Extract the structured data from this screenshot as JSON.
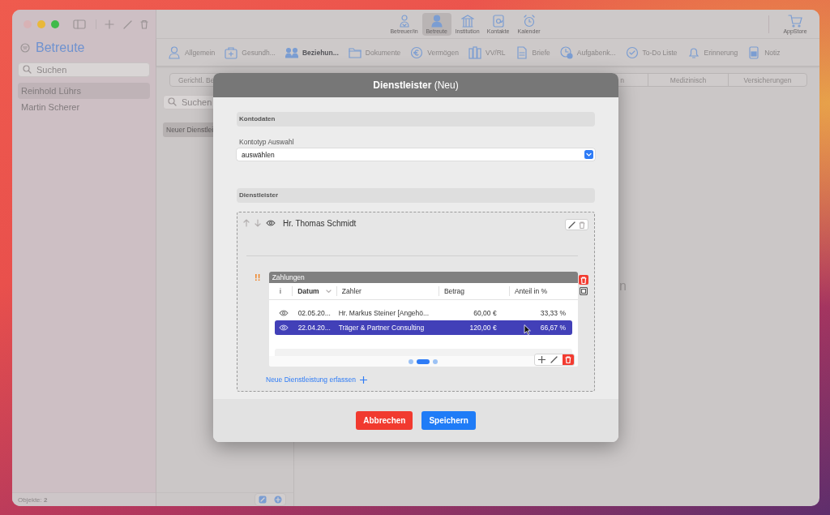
{
  "toolbar": {
    "items": [
      {
        "label": "Betreuer/in",
        "selected": false
      },
      {
        "label": "Betreute",
        "selected": true
      },
      {
        "label": "Institution",
        "selected": false
      },
      {
        "label": "Kontakte",
        "selected": false
      },
      {
        "label": "Kalender",
        "selected": false
      }
    ],
    "store": {
      "label": "AppStore"
    }
  },
  "sidebar": {
    "title": "Betreute",
    "search": {
      "placeholder": "Suchen"
    },
    "items": [
      {
        "label": "Reinhold Lührs",
        "selected": true
      },
      {
        "label": "Martin Scherer",
        "selected": false
      }
    ],
    "footer": "Objekte: **2**"
  },
  "tabs": [
    {
      "label": "Allgemein",
      "selected": false
    },
    {
      "label": "Gesundh...",
      "selected": false
    },
    {
      "label": "Beziehun...",
      "selected": true
    },
    {
      "label": "Dokumente",
      "selected": false
    },
    {
      "label": "Vermögen",
      "selected": false
    },
    {
      "label": "VV/RL",
      "selected": false
    },
    {
      "label": "Briefe",
      "selected": false
    },
    {
      "label": "Aufgabenk...",
      "selected": false
    },
    {
      "label": "To-Do Liste",
      "selected": false
    },
    {
      "label": "Erinnerung",
      "selected": false
    },
    {
      "label": "Notiz",
      "selected": false
    }
  ],
  "segments": [
    {
      "label": "Gerichtl. Be"
    },
    {
      "label": "n"
    },
    {
      "label": "Medizinisch"
    },
    {
      "label": "Versicherungen"
    }
  ],
  "list": {
    "search": {
      "placeholder": "Suchen"
    },
    "items": [
      {
        "label": "Neuer Dienstlei",
        "selected": true
      }
    ]
  },
  "detail_text": "n",
  "dialog": {
    "title": "**Dienstleister** (Neu)",
    "account": {
      "heading": "Kontodaten",
      "field_label": "Kontotyp Auswahl",
      "value": "auswählen"
    },
    "providers": {
      "heading": "Dienstleister",
      "entry": {
        "name": "Hr. Thomas Schmidt",
        "warning": "!!",
        "table": {
          "title": "Zahlungen",
          "columns": [
            {
              "label": "i",
              "sorted": false
            },
            {
              "label": "Datum",
              "sorted": true
            },
            {
              "label": "Zahler",
              "sorted": false
            },
            {
              "label": "Betrag",
              "sorted": false
            },
            {
              "label": "Anteil in %",
              "sorted": false
            }
          ],
          "rows": [
            {
              "date": "02.05.20...",
              "payer": "Hr. Markus Steiner [Angehö...",
              "amount": "60,00 €",
              "share": "33,33 %",
              "selected": false
            },
            {
              "date": "22.04.20...",
              "payer": "Träger & Partner Consulting",
              "amount": "120,00 €",
              "share": "66,67 %",
              "selected": true
            }
          ],
          "pages": [
            {
              "selected": false
            },
            {
              "selected": true
            },
            {
              "selected": false
            }
          ]
        }
      },
      "add_link": "Neue Dienstleistung erfassen"
    },
    "buttons": [
      {
        "label": "Abbrechen",
        "kind": "cancel"
      },
      {
        "label": "Speichern",
        "kind": "save"
      }
    ]
  }
}
